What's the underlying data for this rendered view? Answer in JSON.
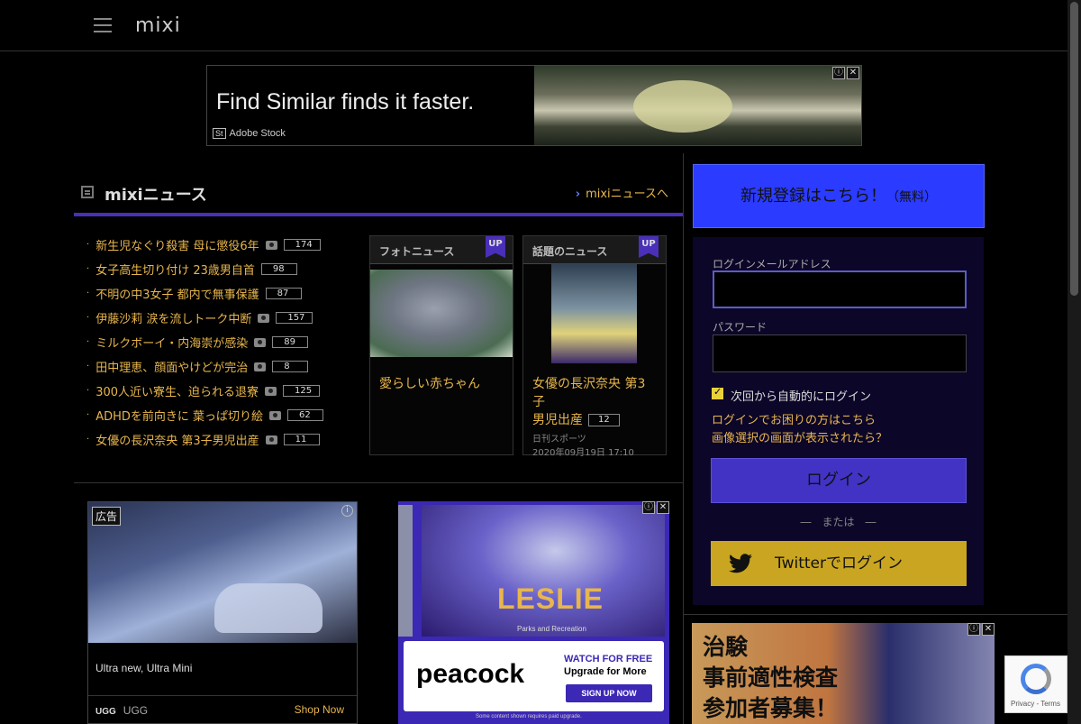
{
  "header": {
    "logo": "mixi",
    "menu_icon": "hamburger-icon"
  },
  "top_ad": {
    "headline": "Find Similar finds it faster.",
    "brand_badge": "St",
    "brand": "Adobe Stock",
    "info": "ⓘ",
    "close": "✕"
  },
  "news": {
    "title": "mixiニュース",
    "more_link": "mixiニュースへ",
    "items": [
      {
        "text": "新生児なぐり殺害 母に懲役6年",
        "photo": true,
        "count": "174"
      },
      {
        "text": "女子高生切り付け 23歳男自首",
        "photo": false,
        "count": "98"
      },
      {
        "text": "不明の中3女子 都内で無事保護",
        "photo": false,
        "count": "87"
      },
      {
        "text": "伊藤沙莉 涙を流しトーク中断",
        "photo": true,
        "count": "157"
      },
      {
        "text": "ミルクボーイ・内海崇が感染",
        "photo": true,
        "count": "89"
      },
      {
        "text": "田中理恵、顔面やけどが完治",
        "photo": true,
        "count": "8"
      },
      {
        "text": "300人近い寮生、迫られる退寮",
        "photo": true,
        "count": "125"
      },
      {
        "text": "ADHDを前向きに 葉っぱ切り絵",
        "photo": true,
        "count": "62"
      },
      {
        "text": "女優の長沢奈央 第3子男児出産",
        "photo": true,
        "count": "11"
      }
    ],
    "photo_card": {
      "header": "フォトニュース",
      "badge": "UP",
      "caption": "愛らしい赤ちゃん"
    },
    "topic_card": {
      "header": "話題のニュース",
      "badge": "UP",
      "caption_line1": "女優の長沢奈央 第3子",
      "caption_line2": "男児出産",
      "count": "12",
      "source": "日刊スポーツ",
      "date": "2020年09月19日 17:10"
    }
  },
  "ad_ugg": {
    "badge": "広告",
    "info": "i",
    "description": "Ultra new, Ultra Mini",
    "brand_logo": "UGG",
    "brand": "UGG",
    "cta": "Shop Now"
  },
  "ad_peacock": {
    "title": "LESLIE",
    "subtitle": "Parks and Recreation",
    "logo": "peacock",
    "watch": "WATCH FOR FREE",
    "upgrade": "Upgrade for More",
    "signup": "SIGN UP NOW",
    "fine_print": "Some content shown requires paid upgrade.",
    "info": "ⓘ",
    "close": "✕"
  },
  "register": {
    "label": "新規登録はこちら！",
    "suffix": "（無料）"
  },
  "login": {
    "email_label": "ログインメールアドレス",
    "email_value": "",
    "password_label": "パスワード",
    "password_value": "",
    "remember_label": "次回から自動的にログイン",
    "remember_checked": true,
    "help_link": "ログインでお困りの方はこちら",
    "image_link": "画像選択の画面が表示されたら？",
    "login_button": "ログイン",
    "or_text": "―　または　―",
    "twitter_button": "Twitterでログイン"
  },
  "ad_right": {
    "line1": "治験",
    "line2": "事前適性検査",
    "line3": "参加者募集！",
    "info": "ⓘ",
    "close": "✕"
  },
  "recaptcha": {
    "text": "Privacy - Terms"
  },
  "colors": {
    "accent": "#4a2fb8",
    "link": "#e8b64c",
    "register": "#2b3bff",
    "login": "#4233c4",
    "twitter": "#c9a521"
  }
}
